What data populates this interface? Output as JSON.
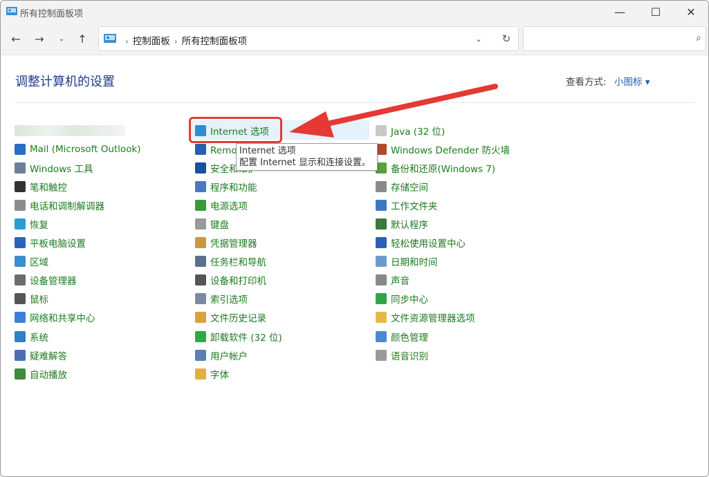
{
  "window": {
    "title": "所有控制面板项"
  },
  "breadcrumb": [
    "控制面板",
    "所有控制面板项"
  ],
  "search": {
    "placeholder": ""
  },
  "page": {
    "heading": "调整计算机的设置",
    "view_label": "查看方式:",
    "view_value": "小图标 ▾"
  },
  "tooltip": {
    "title": "Internet 选项",
    "desc": "配置 Internet 显示和连接设置。"
  },
  "columns": [
    [
      "",
      "Mail (Microsoft Outlook)",
      "Windows 工具",
      "笔和触控",
      "电话和调制解调器",
      "恢复",
      "平板电脑设置",
      "区域",
      "设备管理器",
      "鼠标",
      "网络和共享中心",
      "系统",
      "疑难解答",
      "自动播放"
    ],
    [
      "Internet 选项",
      "RemoteApp 和桌面连接",
      "安全和维护",
      "程序和功能",
      "电源选项",
      "键盘",
      "凭据管理器",
      "任务栏和导航",
      "设备和打印机",
      "索引选项",
      "文件历史记录",
      "卸载软件 (32 位)",
      "用户帐户",
      "字体"
    ],
    [
      "Java (32 位)",
      "Windows Defender 防火墙",
      "备份和还原(Windows 7)",
      "存储空间",
      "工作文件夹",
      "默认程序",
      "轻松使用设置中心",
      "日期和时间",
      "声音",
      "同步中心",
      "文件资源管理器选项",
      "颜色管理",
      "语音识别"
    ]
  ],
  "icon_names": [
    [
      "blurred-icon",
      "mail-icon",
      "windows-tools-icon",
      "pen-icon",
      "phone-modem-icon",
      "recovery-icon",
      "tablet-icon",
      "region-icon",
      "device-manager-icon",
      "mouse-icon",
      "network-icon",
      "system-icon",
      "troubleshoot-icon",
      "autoplay-icon"
    ],
    [
      "internet-globe-icon",
      "remote-desktop-icon",
      "security-flag-icon",
      "programs-icon",
      "power-icon",
      "keyboard-icon",
      "credential-icon",
      "taskbar-icon",
      "printer-icon",
      "index-icon",
      "file-history-icon",
      "uninstall-icon",
      "users-icon",
      "font-icon"
    ],
    [
      "java-icon",
      "firewall-icon",
      "backup-icon",
      "storage-icon",
      "work-folders-icon",
      "default-programs-icon",
      "ease-of-access-icon",
      "date-time-icon",
      "sound-icon",
      "sync-icon",
      "folder-options-icon",
      "color-management-icon",
      "speech-icon"
    ]
  ],
  "icon_colors": [
    [
      "#c9d9c9",
      "#2b6cc4",
      "#6a7f99",
      "#333333",
      "#8c8c8c",
      "#2b9bd6",
      "#2a63b8",
      "#3a8fd0",
      "#6c6c6c",
      "#555555",
      "#3d7fd6",
      "#2f7fc9",
      "#4a6fb5",
      "#3e8a3e"
    ],
    [
      "#2d8fd0",
      "#2b5fae",
      "#1d4f9c",
      "#4a78c2",
      "#3c9a3c",
      "#9a9a9a",
      "#c99a3c",
      "#5a6f8c",
      "#555555",
      "#7a8aa0",
      "#d9a23c",
      "#2fa64a",
      "#5a7fb0",
      "#e0b040"
    ],
    [
      "#c8c8c8",
      "#b04a2a",
      "#5aa03c",
      "#8a8a8a",
      "#3c78c8",
      "#3a7a3a",
      "#2e5fb8",
      "#6a9bd0",
      "#888888",
      "#2fa64a",
      "#e8b84a",
      "#4a8ad0",
      "#999999"
    ]
  ]
}
